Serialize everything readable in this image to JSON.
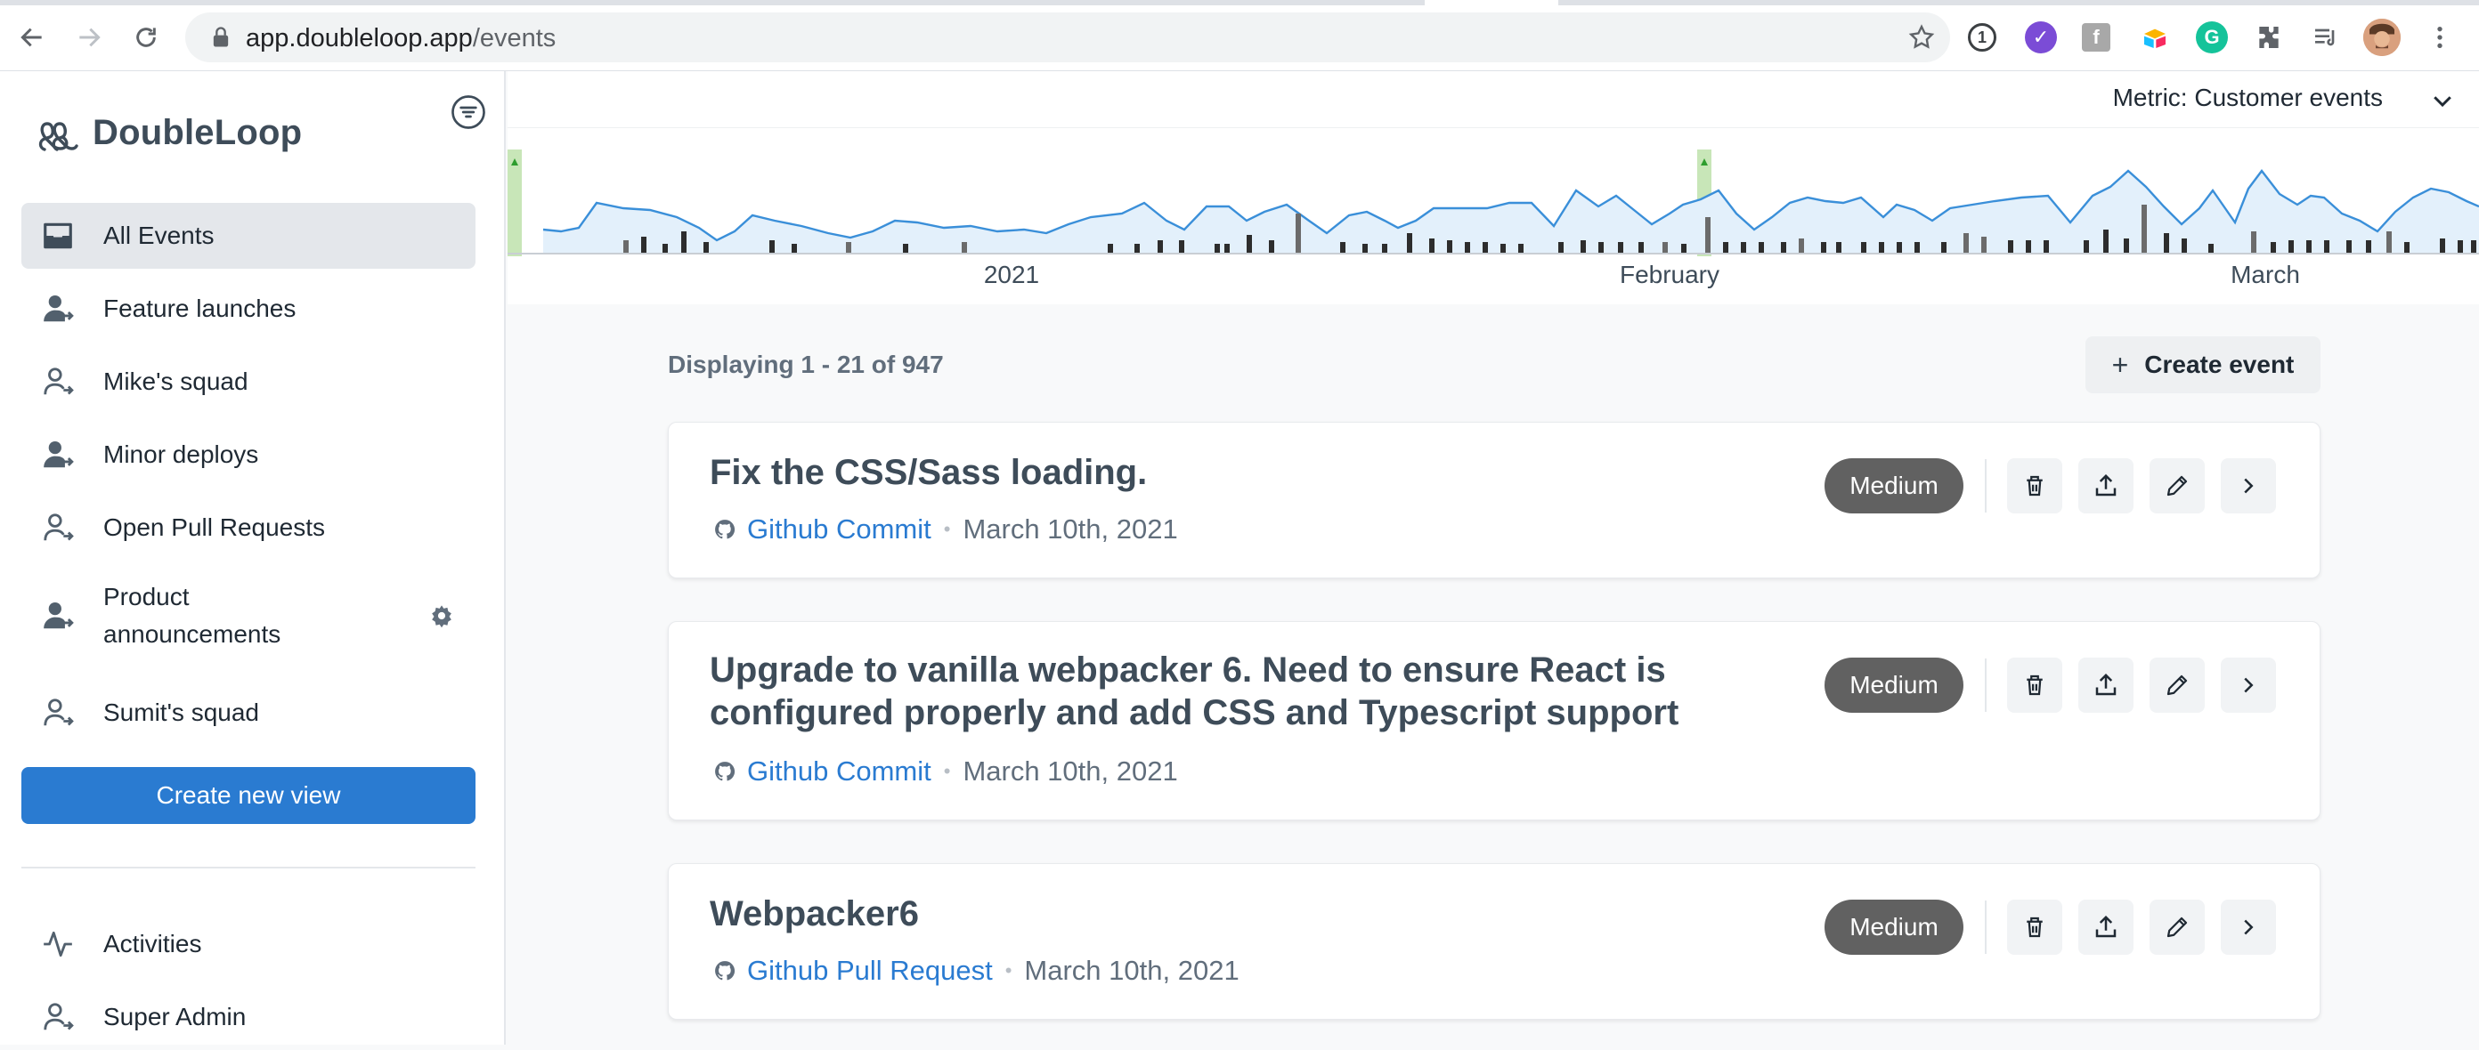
{
  "browser": {
    "url_host": "app.doubleloop.app",
    "url_path": "/events",
    "icons": [
      "back-icon",
      "forward-icon",
      "reload-icon",
      "lock-icon",
      "star-icon",
      "1password-icon",
      "extension-purple-icon",
      "extension-gray-icon",
      "extension-multicolor-icon",
      "grammarly-icon",
      "puzzle-icon",
      "reading-list-icon",
      "avatar",
      "menu-icon"
    ]
  },
  "sidebar": {
    "brand": "DoubleLoop",
    "items": [
      {
        "label": "All Events",
        "icon": "inbox-icon",
        "active": true
      },
      {
        "label": "Feature launches",
        "icon": "user-share-icon"
      },
      {
        "label": "Mike's squad",
        "icon": "user-share-outline-icon"
      },
      {
        "label": "Minor deploys",
        "icon": "user-share-icon"
      },
      {
        "label": "Open Pull Requests",
        "icon": "user-share-outline-icon"
      },
      {
        "label": "Product announcements",
        "icon": "user-share-icon",
        "settings_icon": "gear-icon"
      },
      {
        "label": "Sumit's squad",
        "icon": "user-share-outline-icon"
      }
    ],
    "create_view_label": "Create new view",
    "bottom_items": [
      {
        "label": "Activities",
        "icon": "activity-icon"
      },
      {
        "label": "Super Admin",
        "icon": "user-share-outline-icon"
      }
    ]
  },
  "metric": {
    "label": "Metric: Customer events"
  },
  "timeline": {
    "month_labels": [
      "2021",
      "February",
      "March"
    ],
    "colors": {
      "line": "#3a8fd9",
      "fill": "#e3f0fb",
      "bar": "#2d2d2d",
      "bar_gray": "#6b6b6b",
      "marker": "#c8e6b8",
      "arrow": "#2e9d2e"
    }
  },
  "events": {
    "displaying": "Displaying 1 - 21 of 947",
    "create_label": "Create event",
    "items": [
      {
        "title": "Fix the CSS/Sass loading.",
        "source": "Github Commit",
        "date": "March 10th, 2021",
        "priority": "Medium"
      },
      {
        "title": "Upgrade to vanilla webpacker 6. Need to ensure React is configured properly and add CSS and Typescript support",
        "source": "Github Commit",
        "date": "March 10th, 2021",
        "priority": "Medium"
      },
      {
        "title": "Webpacker6",
        "source": "Github Pull Request",
        "date": "March 10th, 2021",
        "priority": "Medium"
      }
    ]
  }
}
